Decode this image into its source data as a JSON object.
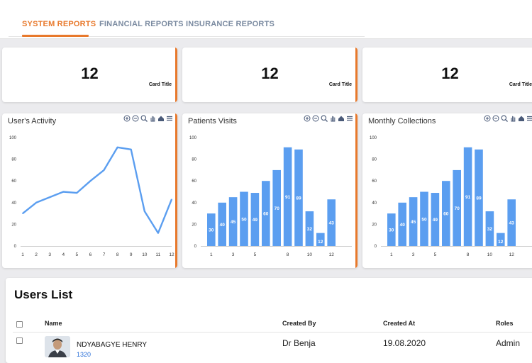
{
  "tabs": [
    {
      "label": "SYSTEM REPORTS",
      "active": true
    },
    {
      "label": "FINANCIAL REPORTS",
      "active": false
    },
    {
      "label": "INSURANCE REPORTS",
      "active": false
    }
  ],
  "stat_cards": [
    {
      "value": "12",
      "title": "Card Title"
    },
    {
      "value": "12",
      "title": "Card Title"
    },
    {
      "value": "12",
      "title": "Card Title"
    }
  ],
  "accent_color": "#e8792c",
  "series_color": "#5b9ef0",
  "toolbar_icons": [
    "zoom-in-icon",
    "zoom-out-icon",
    "magnifier-icon",
    "pan-hand-icon",
    "home-icon",
    "menu-icon"
  ],
  "chart_data": [
    {
      "type": "line",
      "title": "User's Activity",
      "x": [
        1,
        2,
        3,
        4,
        5,
        6,
        7,
        8,
        9,
        10,
        11,
        12
      ],
      "values": [
        30,
        40,
        45,
        50,
        49,
        60,
        70,
        91,
        89,
        32,
        12,
        43
      ],
      "x_tick_labels": [
        "1",
        "2",
        "3",
        "4",
        "5",
        "6",
        "7",
        "8",
        "9",
        "10",
        "11",
        "12"
      ],
      "y_ticks": [
        0,
        20,
        40,
        60,
        80,
        100
      ],
      "ylim": [
        0,
        100
      ],
      "grid": false
    },
    {
      "type": "bar",
      "title": "Patients Visits",
      "x": [
        1,
        2,
        3,
        4,
        5,
        6,
        7,
        8,
        9,
        10,
        11,
        12
      ],
      "values": [
        30,
        40,
        45,
        50,
        49,
        60,
        70,
        91,
        89,
        32,
        12,
        43
      ],
      "x_tick_labels": [
        "1",
        "3",
        "5",
        "8",
        "10",
        "12"
      ],
      "data_labels": true,
      "y_ticks": [
        0,
        20,
        40,
        60,
        80,
        100
      ],
      "ylim": [
        0,
        100
      ],
      "grid": false
    },
    {
      "type": "bar",
      "title": "Monthly Collections",
      "x": [
        1,
        2,
        3,
        4,
        5,
        6,
        7,
        8,
        9,
        10,
        11,
        12
      ],
      "values": [
        30,
        40,
        45,
        50,
        49,
        60,
        70,
        91,
        89,
        32,
        12,
        43
      ],
      "x_tick_labels": [
        "1",
        "3",
        "5",
        "8",
        "10",
        "12"
      ],
      "data_labels": true,
      "y_ticks": [
        0,
        20,
        40,
        60,
        80,
        100
      ],
      "ylim": [
        0,
        100
      ],
      "grid": false
    }
  ],
  "users": {
    "title": "Users List",
    "columns": {
      "name": "Name",
      "created_by": "Created By",
      "created_at": "Created At",
      "roles": "Roles"
    },
    "rows": [
      {
        "name": "NDYABAGYE HENRY",
        "id": "1320",
        "created_by": "Dr Benja",
        "created_at": "19.08.2020",
        "role": "Admin"
      }
    ]
  }
}
